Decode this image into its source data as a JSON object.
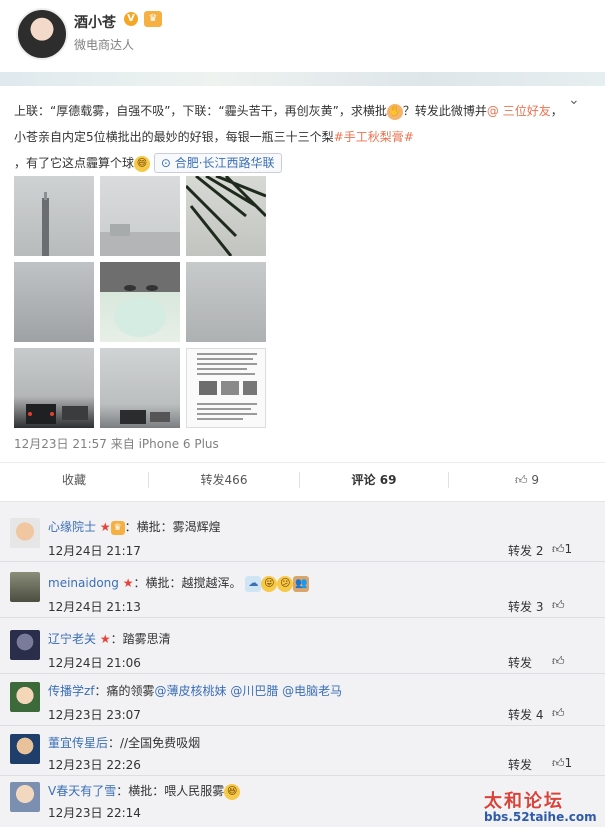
{
  "header": {
    "username": "酒小苍",
    "v_badge": "V",
    "subtitle": "微电商达人"
  },
  "post": {
    "text_1": "上联：“厚德载雾，自强不吸”，下联：“霾头苦干，再创灰黄”，求横批",
    "text_2": "？转发此微博并",
    "mention_at": "@ 三位好友",
    "text_3": "，小苍亲自内定5位横批出的最妙的好银，每银一瓶三十三个梨",
    "hashtag": "#手工秋梨膏#",
    "text_4": "，有了它这点霾算个球",
    "location": "合肥·长江西路华联",
    "timestamp": "12月23日 21:57 来自 iPhone 6 Plus"
  },
  "actions": {
    "favorite": "收藏",
    "repost": "转发466",
    "comment": "评论 69",
    "like": "9"
  },
  "comments": [
    {
      "name": "心缘院士",
      "text": "：横批：雾渴辉煌",
      "time": "12月24日 21:17",
      "repost": "转发 2",
      "likes": "1"
    },
    {
      "name": "meinaidong",
      "text": "：横批：越搅越浑。",
      "time": "12月24日 21:13",
      "repost": "转发 3",
      "likes": ""
    },
    {
      "name": "辽宁老关",
      "text": "：踏雾思清",
      "time": "12月24日 21:06",
      "repost": "转发",
      "likes": ""
    },
    {
      "name": "传播学zf",
      "text": "：痛的领雾",
      "mentions": "@薄皮核桃妹 @川巴腊 @电脑老马",
      "time": "12月23日 23:07",
      "repost": "转发 4",
      "likes": ""
    },
    {
      "name": "董宜传星后",
      "text": "：//全国免费吸烟",
      "time": "12月23日 22:26",
      "repost": "转发",
      "likes": "1"
    },
    {
      "name": "V春天有了雪",
      "text": "：横批：喂人民服雾",
      "time": "12月23日 22:14",
      "repost": "",
      "likes": ""
    }
  ],
  "watermark": {
    "title": "太和论坛",
    "url": "bbs.52taihe.com"
  },
  "colors": {
    "link": "#eb7350",
    "name_blue": "#3b6fb6",
    "comment_bg": "#f2f2f5"
  },
  "icons": [
    "chevron-down-icon",
    "location-pin-icon",
    "thumbs-up-icon",
    "star-icon",
    "crown-icon"
  ]
}
